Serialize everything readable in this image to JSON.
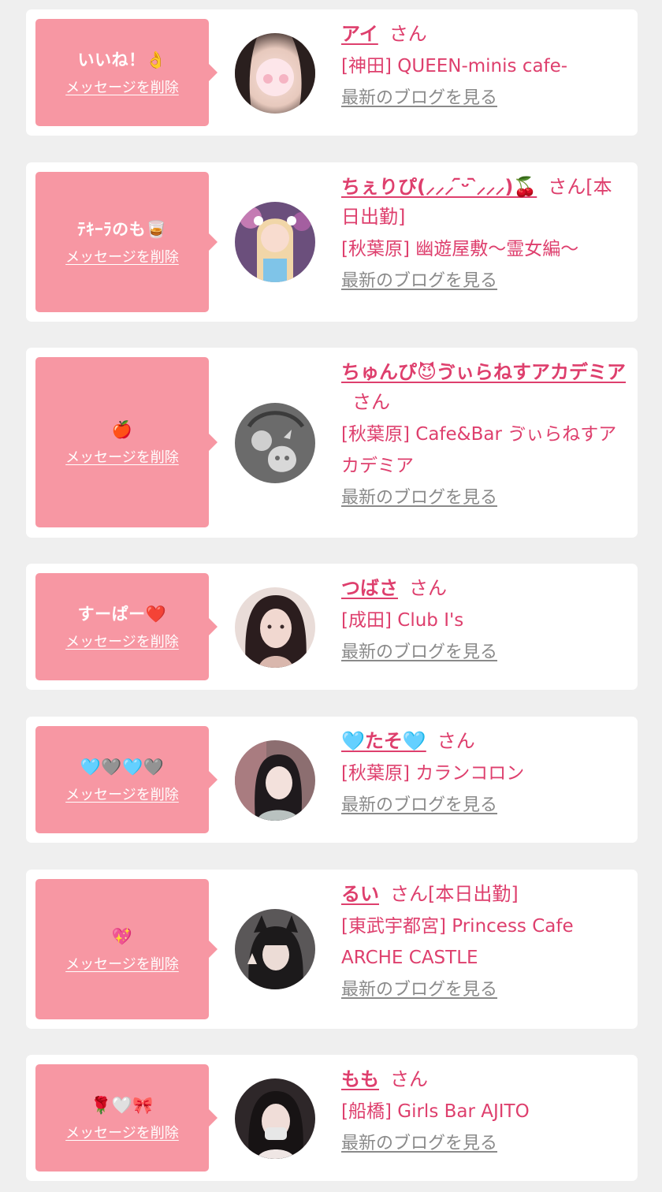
{
  "colors": {
    "background": "#efefef",
    "card": "#ffffff",
    "bubble": "#f797a3",
    "accent": "#de3f6d",
    "link_gray": "#8a8a8a"
  },
  "delete_label": "メッセージを削除",
  "blog_label": "最新のブログを見る",
  "items": [
    {
      "message": "いいね！👌",
      "name": "アイ",
      "suffix": "さん",
      "shop": "[神田] QUEEN-minis cafe-",
      "avatar_icon": "profile-photo-icon"
    },
    {
      "message": "ﾃｷｰﾗのも🥃",
      "name": "ちぇりぴ(⸝⸝⸝ ᷇ᵕ ᷆⸝⸝⸝)🍒",
      "suffix": "さん[本日出勤]",
      "shop": "[秋葉原] 幽遊屋敷～霊女編～",
      "avatar_icon": "profile-photo-icon"
    },
    {
      "message": "🍎",
      "name": "ちゅんぴ😈ゔぃらねすアカデミア",
      "suffix": "さん",
      "shop": "[秋葉原] Cafe&Bar ゔぃらねすアカデミア",
      "avatar_icon": "default-avatar-icon"
    },
    {
      "message": "すーぱー❤️",
      "name": "つばさ",
      "suffix": "さん",
      "shop": "[成田] Club I's",
      "avatar_icon": "profile-photo-icon"
    },
    {
      "message": "🩵🩶🩵🩶",
      "name": "🩵たそ🩵",
      "suffix": "さん",
      "shop": "[秋葉原] カランコロン",
      "avatar_icon": "profile-photo-icon"
    },
    {
      "message": "💖",
      "name": "るい",
      "suffix": "さん[本日出勤]",
      "shop": "[東武宇都宮] Princess Cafe ARCHE CASTLE",
      "avatar_icon": "profile-photo-icon"
    },
    {
      "message": "🌹🤍🎀",
      "name": "もも",
      "suffix": "さん",
      "shop": "[船橋] Girls Bar AJITO",
      "avatar_icon": "profile-photo-icon"
    }
  ]
}
